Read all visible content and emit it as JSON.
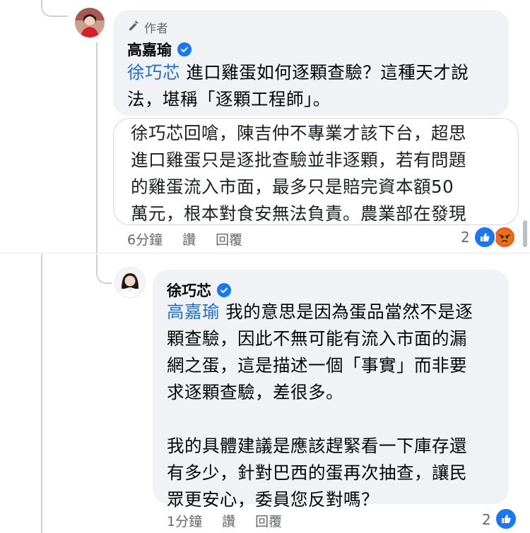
{
  "comment1": {
    "author_tag": "作者",
    "name": "高嘉瑜",
    "mention": "徐巧芯",
    "line1": " 進口雞蛋如何逐顆查驗？這種天才說",
    "line2": "法，堪稱「逐顆工程師」。",
    "quote_lines": [
      "徐巧芯回嗆，陳吉仲不專業才該下台，超思",
      "進口雞蛋只是逐批查驗並非逐顆，若有問題",
      "的雞蛋流入市面，最多只是賠完資本額50",
      "萬元，根本對食安無法負責。農業部在發現"
    ],
    "time": "6分鐘",
    "like": "讚",
    "reply": "回覆",
    "reaction_count": "2",
    "reactions": [
      "like-icon",
      "angry-icon"
    ]
  },
  "comment2": {
    "name": "徐巧芯",
    "mention": "高嘉瑜",
    "para1_lines": [
      " 我的意思是因為蛋品當然不是逐",
      "顆查驗，因此不無可能有流入市面的漏",
      "網之蛋，這是描述一個「事實」而非要",
      "求逐顆查驗，差很多。"
    ],
    "para2_lines": [
      "我的具體建議是應該趕緊看一下庫存還",
      "有多少，針對巴西的蛋再次抽查，讓民",
      "眾更安心，委員您反對嗎？"
    ],
    "time": "1分鐘",
    "like": "讚",
    "reply": "回覆",
    "reaction_count": "2",
    "reactions": [
      "like-icon"
    ]
  },
  "colors": {
    "bubble": "#f0f2f5",
    "mention": "#1a6fd9",
    "verified": "#1877f2",
    "secondary_text": "#65676b"
  }
}
